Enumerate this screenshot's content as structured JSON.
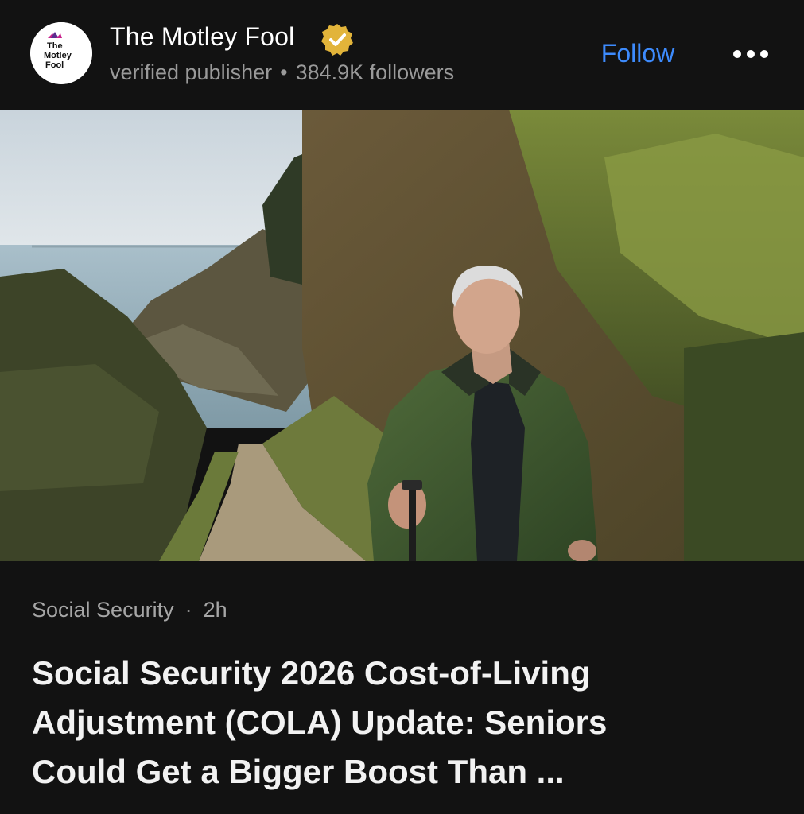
{
  "publisher": {
    "name": "The Motley Fool",
    "logo_text": [
      "The",
      "Motley",
      "Fool"
    ],
    "verification": "verified publisher",
    "followers": "384.9K followers",
    "verified_icon": "verified-badge-icon"
  },
  "actions": {
    "follow_label": "Follow",
    "more_icon": "more-options-icon"
  },
  "hero": {
    "description_icon": "article-hero-image"
  },
  "article": {
    "category": "Social Security",
    "time": "2h",
    "headline_lines": [
      "Social Security 2026 Cost-of-Living",
      "Adjustment (COLA) Update: Seniors",
      "Could Get a Bigger Boost Than ..."
    ]
  },
  "colors": {
    "background": "#121212",
    "follow": "#3d8bfd",
    "muted_text": "#9a9a9a",
    "verified_badge": "#e2b43a"
  }
}
